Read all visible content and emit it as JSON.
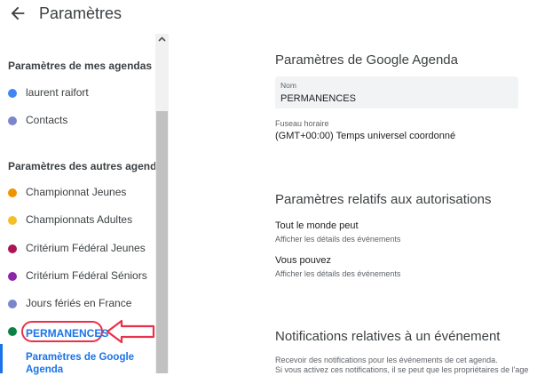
{
  "header": {
    "title": "Paramètres"
  },
  "sidebar": {
    "my_calendars_heading": "Paramètres de mes agendas",
    "my_calendars": [
      {
        "label": "laurent raifort",
        "color": "#4285f4"
      },
      {
        "label": "Contacts",
        "color": "#7986cb"
      }
    ],
    "other_calendars_heading": "Paramètres des autres agendas",
    "other_calendars": [
      {
        "label": "Championnat Jeunes",
        "color": "#f09300"
      },
      {
        "label": "Championnats Adultes",
        "color": "#f6bf26"
      },
      {
        "label": "Critérium Fédéral Jeunes",
        "color": "#ad1457"
      },
      {
        "label": "Critérium Fédéral Séniors",
        "color": "#8e24aa"
      },
      {
        "label": "Jours fériés en France",
        "color": "#7986cb"
      }
    ],
    "selected": {
      "label": "PERMANENCES",
      "color": "#0b8043"
    },
    "selected_sub": "Paramètres de Google Agenda"
  },
  "main": {
    "section1_title": "Paramètres de Google Agenda",
    "name_caption": "Nom",
    "name_value": "PERMANENCES",
    "timezone_caption": "Fuseau horaire",
    "timezone_value": "(GMT+00:00) Temps universel coordonné",
    "section2_title": "Paramètres relatifs aux autorisations",
    "perm1_title": "Tout le monde peut",
    "perm1_value": "Afficher les détails des événements",
    "perm2_title": "Vous pouvez",
    "perm2_value": "Afficher les détails des événements",
    "section3_title": "Notifications relatives à un événement",
    "notif_line1": "Recevoir des notifications pour les événements de cet agenda.",
    "notif_line2": "Si vous activez ces notifications, il se peut que les propriétaires de l'age"
  },
  "colors": {
    "accent": "#1a73e8",
    "highlight": "#e8314b"
  }
}
